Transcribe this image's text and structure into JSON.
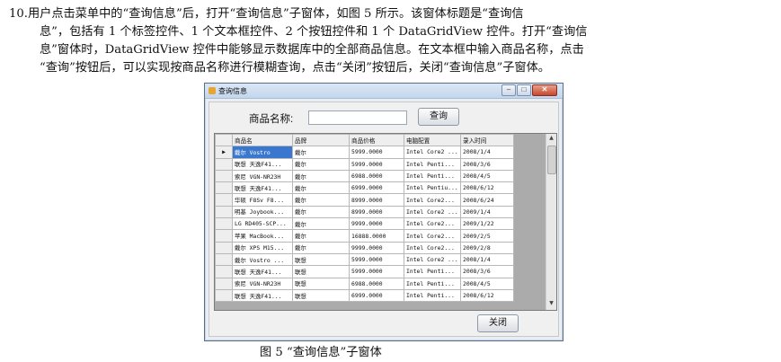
{
  "paragraph": {
    "line1": "10.用户点击菜单中的“查询信息”后，打开“查询信息”子窗体，如图 5 所示。该窗体标题是“查询信",
    "line2": "息”，包括有 1 个标签控件、1 个文本框控件、2 个按钮控件和 1 个 DataGridView 控件。打开“查询信",
    "line3": "息”窗体时，DataGridView 控件中能够显示数据库中的全部商品信息。在文本框中输入商品名称，点击",
    "line4": "“查询”按钮后，可以实现按商品名称进行模糊查询，点击“关闭”按钮后，关闭“查询信息”子窗体。"
  },
  "window": {
    "title": "查询信息",
    "label": "商品名称:",
    "search_value": "",
    "query_button": "查询",
    "close_button": "关闭",
    "row_pointer": "▶"
  },
  "grid": {
    "columns": [
      "商品名",
      "品牌",
      "商品价格",
      "电脑配置",
      "录入时间"
    ],
    "rows": [
      [
        "戴尔 Vostro",
        "戴尔",
        "5999.0000",
        "Intel Core2 ...",
        "2008/1/4"
      ],
      [
        "联想 天逸F41...",
        "戴尔",
        "5999.0000",
        "Intel Penti...",
        "2008/3/6"
      ],
      [
        "索尼 VGN-NR23H",
        "戴尔",
        "6988.0000",
        "Intel Penti...",
        "2008/4/5"
      ],
      [
        "联想 天逸F41...",
        "戴尔",
        "6999.0000",
        "Intel Pentiu...",
        "2008/6/12"
      ],
      [
        "华硕 F8Sv F8...",
        "戴尔",
        "8999.0000",
        "Intel Core2...",
        "2008/6/24"
      ],
      [
        "明基 Joybook...",
        "戴尔",
        "8999.0000",
        "Intel Core2 ...",
        "2009/1/4"
      ],
      [
        "LG RD405-SCP...",
        "戴尔",
        "9999.0000",
        "Intel Core2...",
        "2009/1/22"
      ],
      [
        "苹果 MacBook...",
        "戴尔",
        "16888.0000",
        "Intel Core2...",
        "2009/2/5"
      ],
      [
        "戴尔 XPS M15...",
        "戴尔",
        "9999.0000",
        "Intel Core2...",
        "2009/2/8"
      ],
      [
        "戴尔 Vostro ...",
        "联想",
        "5999.0000",
        "Intel Core2 ...",
        "2008/1/4"
      ],
      [
        "联想 天逸F41...",
        "联想",
        "5999.0000",
        "Intel Penti...",
        "2008/3/6"
      ],
      [
        "索尼 VGN-NR23H",
        "联想",
        "6988.0000",
        "Intel Penti...",
        "2008/4/5"
      ],
      [
        "联想 天逸F41...",
        "联想",
        "6999.0000",
        "Intel Penti...",
        "2008/6/12"
      ]
    ]
  },
  "caption": "图 5 “查询信息”子窗体",
  "colors": {
    "selection": "#3a78d0",
    "titlebar": "#c4d6ec",
    "close": "#c7472b"
  }
}
